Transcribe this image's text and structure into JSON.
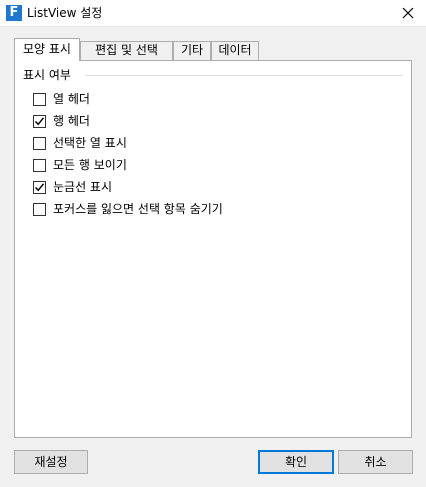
{
  "window": {
    "title": "ListView 설정",
    "app_icon_letter": "F"
  },
  "tabs": [
    {
      "label": "모양 표시",
      "active": true
    },
    {
      "label": "편집 및 선택",
      "active": false
    },
    {
      "label": "기타",
      "active": false
    },
    {
      "label": "데이터",
      "active": false
    }
  ],
  "group": {
    "title": "표시 여부"
  },
  "options": [
    {
      "label": "열 헤더",
      "checked": false
    },
    {
      "label": "행 헤더",
      "checked": true
    },
    {
      "label": "선택한 열 표시",
      "checked": false
    },
    {
      "label": "모든 행 보이기",
      "checked": false
    },
    {
      "label": "눈금선 표시",
      "checked": true
    },
    {
      "label": "포커스를 잃으면 선택 항목 숨기기",
      "checked": false
    }
  ],
  "buttons": {
    "reset": "재설정",
    "ok": "확인",
    "cancel": "취소"
  },
  "colors": {
    "accent": "#0078d7",
    "app_icon": "#1f77d0"
  }
}
